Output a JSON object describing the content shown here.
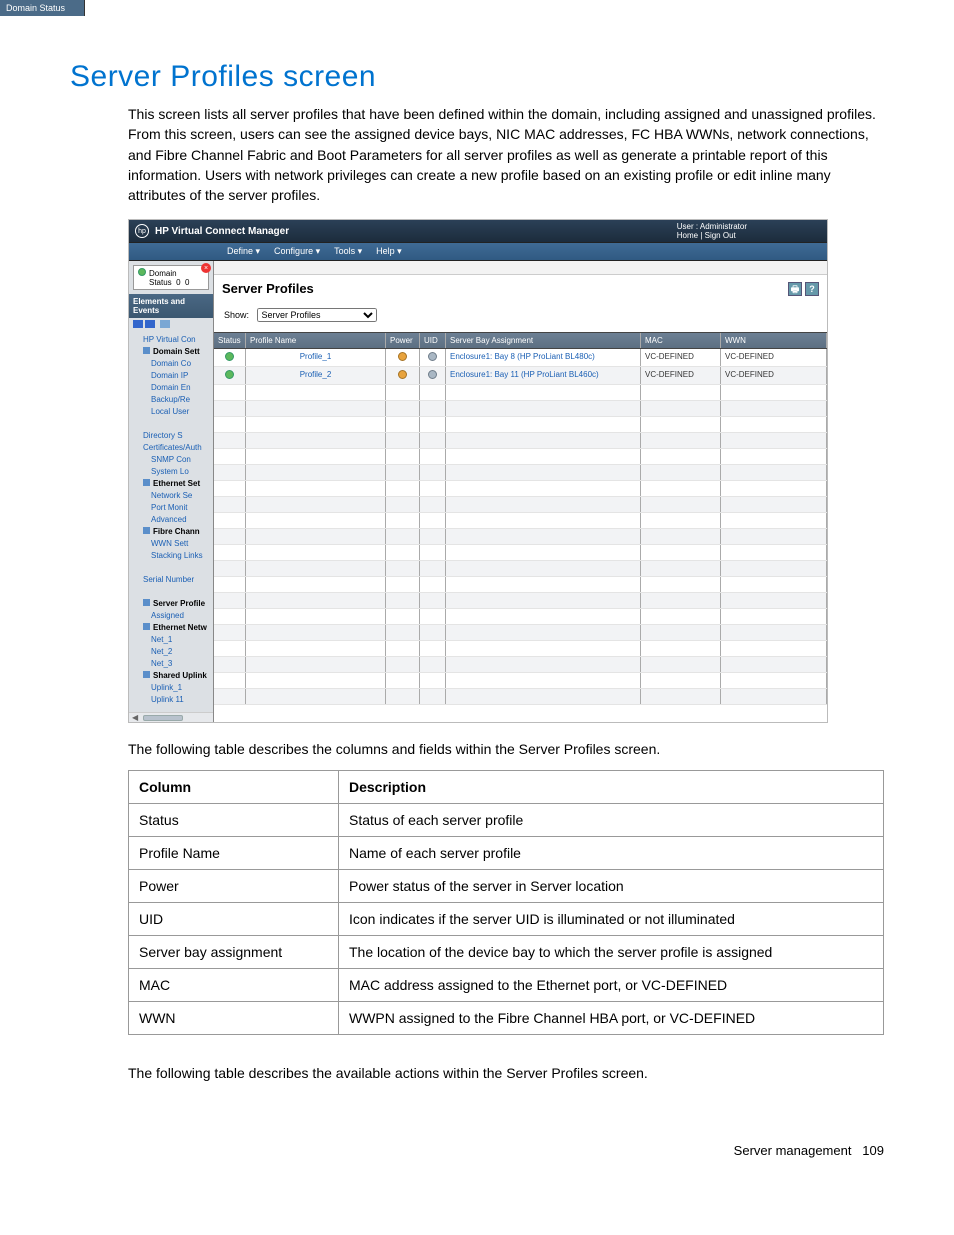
{
  "page": {
    "title": "Server Profiles screen",
    "intro": "This screen lists all server profiles that have been defined within the domain, including assigned and unassigned profiles. From this screen, users can see the assigned device bays, NIC MAC addresses, FC HBA WWNs, network connections, and Fibre Channel Fabric and Boot Parameters for all server profiles as well as generate a printable report of this information. Users with network privileges can create a new profile based on an existing profile or edit inline many attributes of the server profiles.",
    "desc_intro": "The following table describes the columns and fields within the Server Profiles screen.",
    "actions_intro": "The following table describes the available actions within the Server Profiles screen.",
    "footer_section": "Server management",
    "footer_page": "109"
  },
  "app": {
    "title": "HP Virtual Connect Manager",
    "user_line1": "User : Administrator",
    "user_line2": "Home  |  Sign Out",
    "menubar": {
      "status": "Domain Status",
      "m1": "Define ▾",
      "m2": "Configure ▾",
      "m3": "Tools ▾",
      "m4": "Help ▾"
    },
    "domain_status": {
      "label1": "Domain",
      "label2": "Status",
      "c1": "0",
      "c2": "0"
    },
    "sidebar": {
      "heading": "Elements and Events",
      "items": [
        "HP Virtual Con",
        "Domain Sett",
        "Domain Co",
        "Domain IP",
        "Domain En",
        "Backup/Re",
        "Local User",
        "",
        "Directory S",
        "Certificates/Auth",
        "SNMP Con",
        "System Lo",
        "Ethernet Set",
        "Network Se",
        "Port Monit",
        "Advanced",
        "Fibre Chann",
        "WWN Sett",
        "Stacking Links",
        "",
        "Serial Number",
        "",
        "Server Profile",
        "Assigned",
        "Ethernet Netw",
        "Net_1",
        "Net_2",
        "Net_3",
        "Shared Uplink",
        "Uplink_1",
        "Uplink 11"
      ]
    },
    "main": {
      "heading": "Server Profiles",
      "show_label": "Show:",
      "show_value": "Server Profiles",
      "columns": {
        "status": "Status",
        "name": "Profile Name",
        "power": "Power",
        "uid": "UID",
        "bay": "Server Bay Assignment",
        "mac": "MAC",
        "wwn": "WWN"
      },
      "rows": [
        {
          "name": "Profile_1",
          "bay": "Enclosure1: Bay 8 (HP ProLiant BL480c)",
          "mac": "VC-DEFINED",
          "wwn": "VC-DEFINED"
        },
        {
          "name": "Profile_2",
          "bay": "Enclosure1: Bay 11 (HP ProLiant BL460c)",
          "mac": "VC-DEFINED",
          "wwn": "VC-DEFINED"
        }
      ]
    }
  },
  "desc_table": {
    "h1": "Column",
    "h2": "Description",
    "rows": [
      {
        "c": "Status",
        "d": "Status of each server profile"
      },
      {
        "c": "Profile Name",
        "d": "Name of each server profile"
      },
      {
        "c": "Power",
        "d": "Power status of the server in Server location"
      },
      {
        "c": "UID",
        "d": "Icon indicates if the server UID is illuminated or not illuminated"
      },
      {
        "c": "Server bay assignment",
        "d": "The location of the device bay to which the server profile is assigned"
      },
      {
        "c": "MAC",
        "d": "MAC address assigned to the Ethernet port, or VC-DEFINED"
      },
      {
        "c": "WWN",
        "d": "WWPN assigned to the Fibre Channel HBA port, or VC-DEFINED"
      }
    ]
  }
}
